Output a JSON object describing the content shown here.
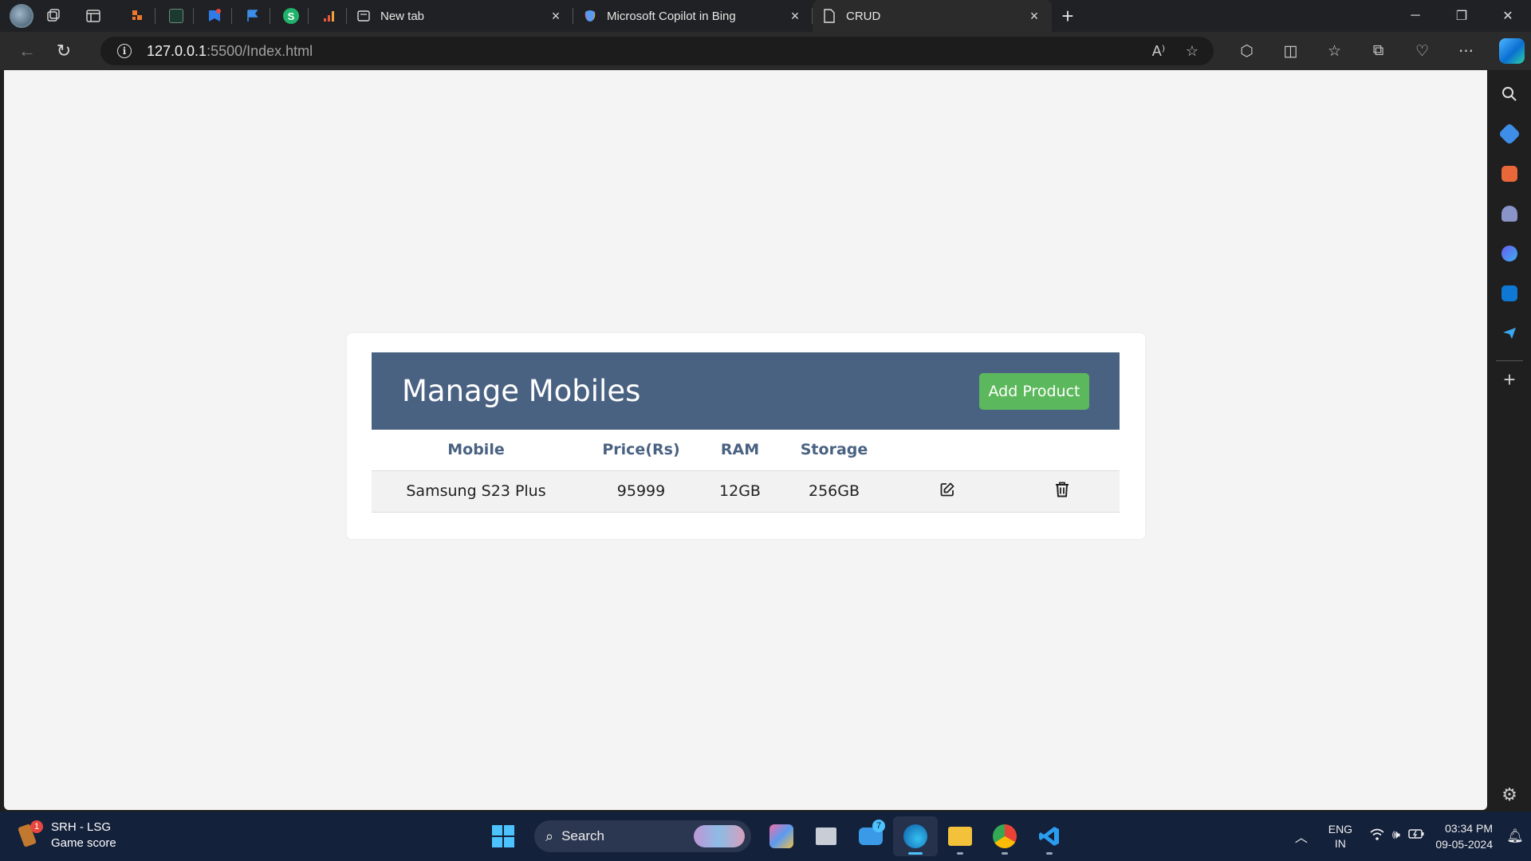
{
  "browser": {
    "pinned_tabs": [
      {
        "icon": "orange-app-icon",
        "color": "#f0782d"
      },
      {
        "icon": "cursor-app-icon",
        "color": "#1c3b2e"
      },
      {
        "icon": "blue-bookmark-app-icon",
        "color": "#2f7be8"
      },
      {
        "icon": "flag-app-icon",
        "color": "#3a8ee8"
      },
      {
        "icon": "s-app-icon",
        "color": "#1fb36b",
        "letter": "S"
      },
      {
        "icon": "chart-app-icon",
        "color": "#e8573a"
      }
    ],
    "tabs": [
      {
        "title": "New tab",
        "icon": "new-tab-page-icon",
        "active": false
      },
      {
        "title": "Microsoft Copilot in Bing",
        "icon": "copilot-icon",
        "active": false
      },
      {
        "title": "CRUD",
        "icon": "document-icon",
        "active": true
      }
    ],
    "address": {
      "host": "127.0.0.1",
      "rest": ":5500/Index.html"
    },
    "accent": "#4a6282"
  },
  "page": {
    "title": "Manage Mobiles",
    "add_button": "Add Product",
    "columns": [
      "Mobile",
      "Price(Rs)",
      "RAM",
      "Storage"
    ],
    "rows": [
      {
        "mobile": "Samsung S23 Plus",
        "price": "95999",
        "ram": "12GB",
        "storage": "256GB"
      }
    ],
    "colors": {
      "header": "#4a6282",
      "button": "#5cb85c"
    }
  },
  "taskbar": {
    "widget": {
      "title": "SRH - LSG",
      "subtitle": "Game score",
      "badge": "1"
    },
    "search_placeholder": "Search",
    "mail_badge": "7",
    "tray": {
      "lang_top": "ENG",
      "lang_bottom": "IN",
      "time": "03:34 PM",
      "date": "09-05-2024"
    }
  }
}
